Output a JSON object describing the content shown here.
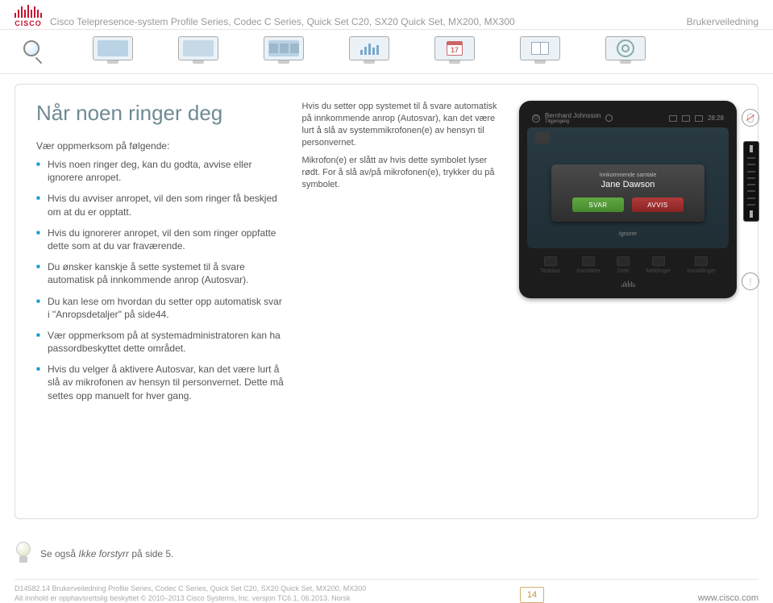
{
  "header": {
    "logo_text": "CISCO",
    "title": "Cisco Telepresence-system Profile Series, Codec C Series, Quick Set C20, SX20 Quick Set, MX200, MX300",
    "right": "Brukerveiledning"
  },
  "nav": {
    "calendar_day": "17"
  },
  "page": {
    "title": "Når noen ringer deg",
    "intro_head": "Vær oppmerksom på følgende:",
    "bullets": [
      "Hvis noen ringer deg, kan du godta, avvise eller ignorere anropet.",
      "Hvis du avviser anropet, vil den som ringer få beskjed om at du er opptatt.",
      "Hvis du ignorerer anropet, vil den som ringer oppfatte dette som at du var fraværende.",
      "Du ønsker kanskje å sette systemet til å svare automatisk på innkommende anrop (Autosvar).",
      "Du kan lese om hvordan du setter opp automatisk svar i \"Anropsdetaljer\" på side44.",
      "Vær oppmerksom på at systemadministratoren kan ha passordbeskyttet dette området.",
      "Hvis du velger å aktivere Autosvar, kan det være lurt å slå av mikrofonen av hensyn til personvernet. Dette må settes opp manuelt for hver gang."
    ],
    "mid_top": "Hvis du setter opp systemet til å svare automatisk på innkommende anrop (Autosvar), kan det være lurt å slå av systemmikrofonen(e) av hensyn til personvernet.",
    "mid_bottom": "Mikrofon(e) er slått av hvis dette symbolet lyser rødt. For å slå av/på mikrofonen(e), trykker du på symbolet."
  },
  "device": {
    "top_caller_name": "Bernhard Johnsson",
    "top_caller_sub": "Tilgjengelig",
    "clock": "28:28",
    "popup_sub": "Innkommende samtale",
    "popup_name": "Jane Dawson",
    "btn_accept": "SVAR",
    "btn_reject": "AVVIS",
    "ignore": "Ignorer",
    "bottom_items": [
      "Tastatur",
      "Kontakter",
      "Dele",
      "Meldinger",
      "Innstillinger"
    ]
  },
  "tip": {
    "prefix": "Se også ",
    "link": "Ikke forstyrr",
    "suffix": " på side 5."
  },
  "footer": {
    "line1": "D14582.14 Brukerveiledning Profile Series, Codec C Series, Quick Set C20, SX20 Quick Set, MX200, MX300",
    "line2": "Alt innhold er opphavsrettslig beskyttet © 2010–2013 Cisco Systems, Inc. versjon TC6.1, 06.2013. Norsk",
    "page_number": "14",
    "url": "www.cisco.com"
  }
}
